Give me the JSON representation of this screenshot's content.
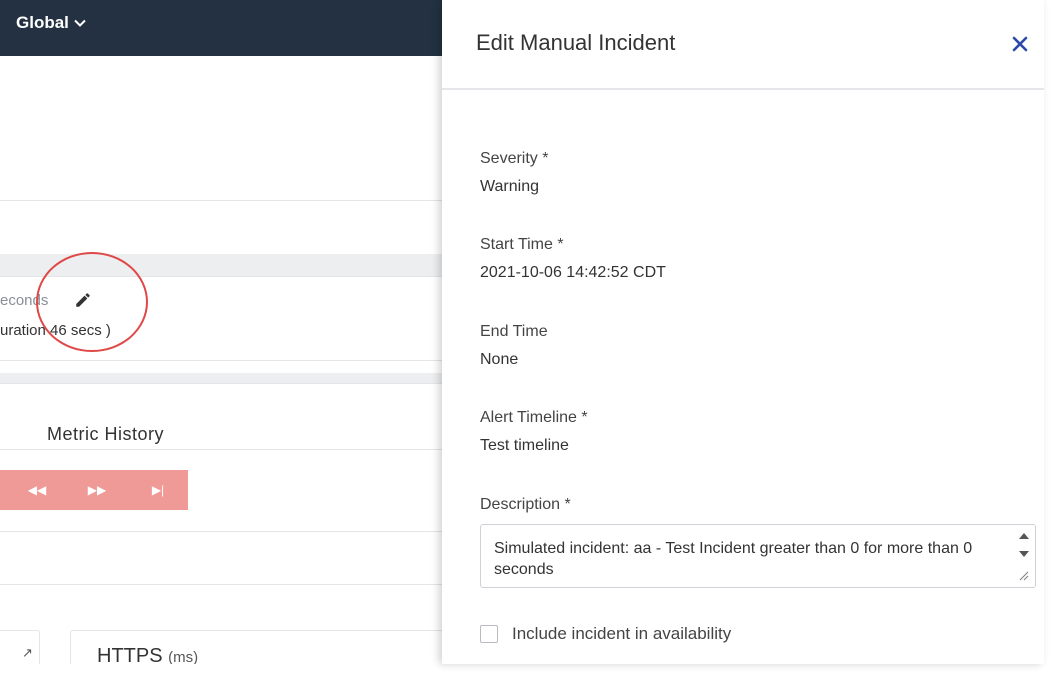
{
  "topbar": {
    "global_label": "Global"
  },
  "incident_row": {
    "duration_text": "econds",
    "duration_sub": "uration 46 secs )"
  },
  "metric": {
    "title": "Metric History"
  },
  "playback": {
    "rewind": "◀◀",
    "fast_forward": "▶▶",
    "skip_end": "▶|"
  },
  "cards": [
    {
      "title": "HTTPS",
      "unit": "(ms)"
    }
  ],
  "drawer": {
    "title": "Edit Manual Incident",
    "severity": {
      "label": "Severity *",
      "value": "Warning"
    },
    "start_time": {
      "label": "Start Time *",
      "value": "2021-10-06 14:42:52 CDT"
    },
    "end_time": {
      "label": "End Time",
      "value": "None"
    },
    "alert_timeline": {
      "label": "Alert Timeline *",
      "value": "Test timeline"
    },
    "description": {
      "label": "Description *",
      "value": "Simulated incident: aa - Test Incident greater than 0 for more than 0 seconds"
    },
    "include_availability": {
      "label": "Include incident in availability",
      "checked": false
    }
  },
  "colors": {
    "topbar": "#233142",
    "accent": "#2d4aa8",
    "playbar": "#ef9a96",
    "highlight_circle": "#e04848"
  },
  "icons": {
    "dropdown": "chevron-down-icon",
    "edit": "pencil-icon",
    "close": "close-icon"
  }
}
